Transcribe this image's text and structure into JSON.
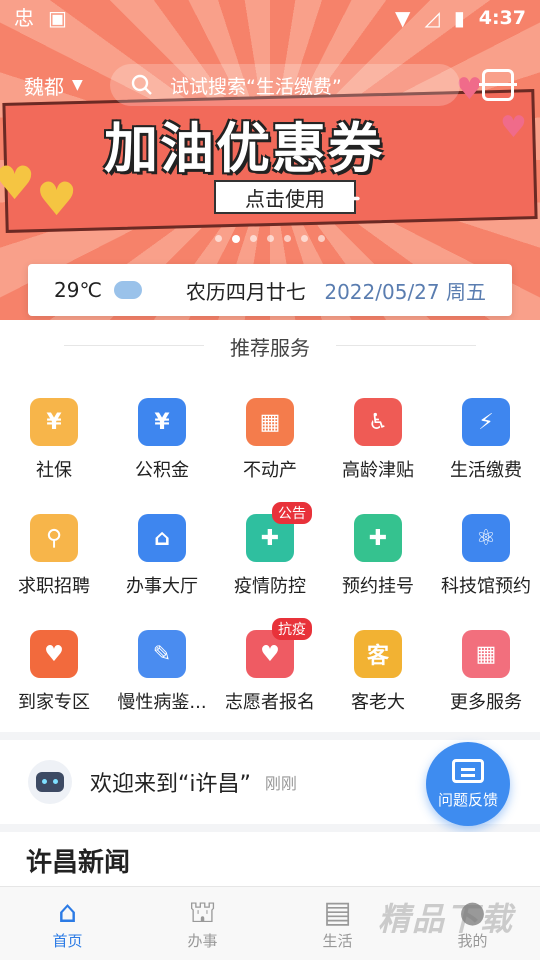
{
  "status_bar": {
    "app_glyph": "忠",
    "time": "4:37"
  },
  "header": {
    "city": "魏都",
    "search_placeholder": "试试搜索“生活缴费”",
    "banner_title": "加油优惠券",
    "banner_button": "点击使用",
    "carousel_total": 7,
    "carousel_active": 2
  },
  "weather": {
    "temperature": "29℃",
    "lunar_date": "农历四月廿七",
    "date": "2022/05/27 周五"
  },
  "services": {
    "title": "推荐服务",
    "items": [
      {
        "label": "社保",
        "icon": "social-security-icon",
        "color": "#f7b54a",
        "glyph": "¥"
      },
      {
        "label": "公积金",
        "icon": "housing-fund-icon",
        "color": "#3e86ef",
        "glyph": "¥"
      },
      {
        "label": "不动产",
        "icon": "real-estate-icon",
        "color": "#f47c4c",
        "glyph": "▦"
      },
      {
        "label": "高龄津贴",
        "icon": "elderly-allowance-icon",
        "color": "#ef5b55",
        "glyph": "♿"
      },
      {
        "label": "生活缴费",
        "icon": "utility-payment-icon",
        "color": "#3e86ef",
        "glyph": "⚡"
      },
      {
        "label": "求职招聘",
        "icon": "job-search-icon",
        "color": "#f7b54a",
        "glyph": "⚲"
      },
      {
        "label": "办事大厅",
        "icon": "service-hall-icon",
        "color": "#3e86ef",
        "glyph": "⌂"
      },
      {
        "label": "疫情防控",
        "icon": "epidemic-control-icon",
        "color": "#2fbf9f",
        "glyph": "✚",
        "badge": "公告"
      },
      {
        "label": "预约挂号",
        "icon": "appointment-icon",
        "color": "#35c28f",
        "glyph": "✚"
      },
      {
        "label": "科技馆预约",
        "icon": "science-museum-icon",
        "color": "#3e86ef",
        "glyph": "⚛"
      },
      {
        "label": "到家专区",
        "icon": "home-service-icon",
        "color": "#f26a3d",
        "glyph": "♥"
      },
      {
        "label": "慢性病鉴...",
        "icon": "chronic-disease-icon",
        "color": "#4a8cf0",
        "glyph": "✎"
      },
      {
        "label": "志愿者报名",
        "icon": "volunteer-icon",
        "color": "#ef5b63",
        "glyph": "♥",
        "badge": "抗疫"
      },
      {
        "label": "客老大",
        "icon": "kelaoda-logo-icon",
        "color": "#f2b233",
        "glyph": "客"
      },
      {
        "label": "更多服务",
        "icon": "more-services-icon",
        "color": "#f26f7d",
        "glyph": "▦"
      }
    ]
  },
  "welcome": {
    "text": "欢迎来到“i许昌”",
    "time": "刚刚"
  },
  "feedback": {
    "label": "问题反馈"
  },
  "news": {
    "title": "许昌新闻"
  },
  "bottom_nav": [
    {
      "label": "首页",
      "icon": "home-icon",
      "active": true
    },
    {
      "label": "办事",
      "icon": "service-hall-icon",
      "active": false
    },
    {
      "label": "生活",
      "icon": "store-icon",
      "active": false
    },
    {
      "label": "我的",
      "icon": "user-icon",
      "active": false
    }
  ],
  "watermark": "精品下载"
}
